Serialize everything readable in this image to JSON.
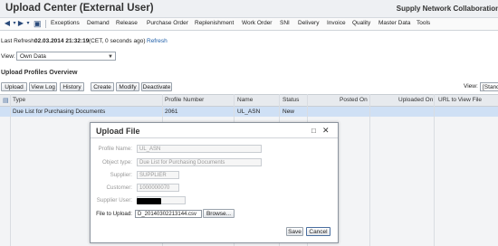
{
  "window": {
    "title": "Upload Center (External User)",
    "brand": "Supply Network Collaboration"
  },
  "menu": {
    "icons": [
      "back-arrow-icon",
      "forward-arrow-icon",
      "save-icon"
    ],
    "items": [
      "Exceptions",
      "Demand",
      "Release",
      "Purchase Order",
      "Replenishment",
      "Work Order",
      "SNI",
      "Delivery",
      "Invoice",
      "Quality",
      "Master Data",
      "Tools"
    ]
  },
  "status": {
    "last_refresh_label": "Last Refresh:",
    "last_refresh_value": "02.03.2014 21:32:19",
    "last_refresh_tz": "(CET, 0 seconds ago)",
    "refresh_link": "Refresh"
  },
  "view_filter": {
    "label": "View:",
    "value": "Own Data"
  },
  "section": {
    "title": "Upload Profiles Overview"
  },
  "toolbar": {
    "buttons": [
      "Upload",
      "View Log",
      "History",
      "Create",
      "Modify",
      "Deactivate"
    ],
    "view_label": "View:",
    "view_value": "[Standard]"
  },
  "table": {
    "headers": [
      "Type",
      "Profile Number",
      "Name",
      "Status",
      "Posted On",
      "Uploaded On",
      "URL to View File"
    ],
    "rows": [
      {
        "type": "Due List for Purchasing Documents",
        "profile_number": "2061",
        "name": "UL_ASN",
        "status": "New",
        "posted_on": "",
        "uploaded_on": "",
        "url": ""
      }
    ]
  },
  "dialog": {
    "title": "Upload File",
    "fields": {
      "profile_name": {
        "label": "Profile Name:",
        "value": "UL_ASN"
      },
      "object_type": {
        "label": "Object type:",
        "value": "Due List for Purchasing Documents"
      },
      "supplier": {
        "label": "Supplier:",
        "value": "SUPPLIER"
      },
      "customer": {
        "label": "Customer:",
        "value": "1000000070"
      },
      "supplier_user": {
        "label": "Supplier User:",
        "value": ""
      },
      "file_to_upload": {
        "label": "File to Upload:",
        "value": "D_20140302213144.csv"
      }
    },
    "browse_label": "Browse...",
    "save_label": "Save",
    "cancel_label": "Cancel"
  },
  "colors": {
    "accent": "#1f5fa8",
    "row_selected": "#cfe0f5"
  }
}
